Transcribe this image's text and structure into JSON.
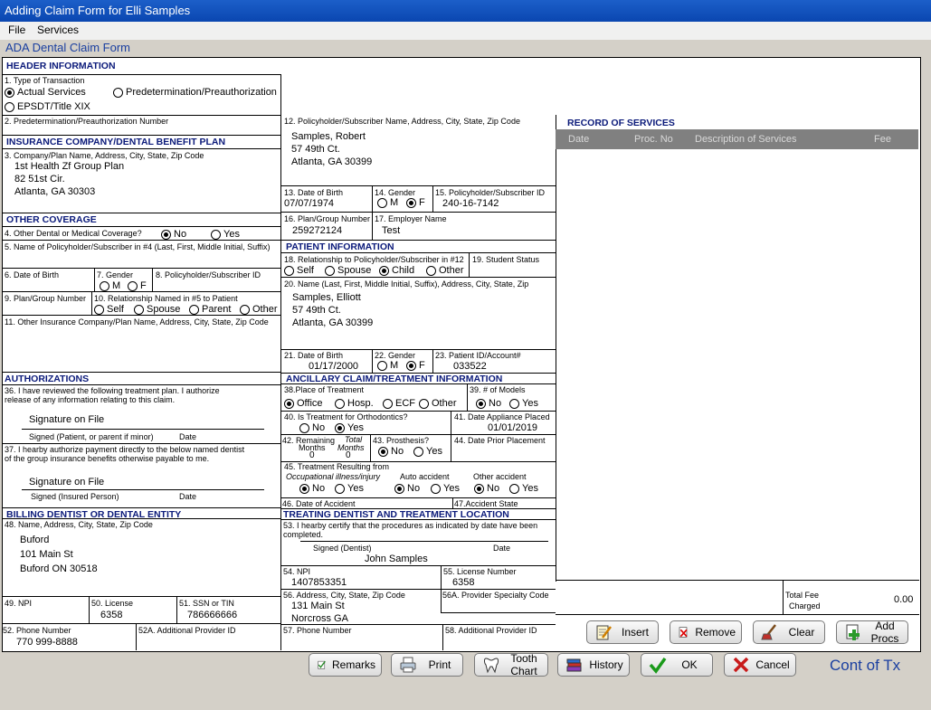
{
  "window": {
    "title": "Adding Claim Form for Elli Samples"
  },
  "menu": [
    "File",
    "Services"
  ],
  "form_title": "ADA Dental Claim Form",
  "header": {
    "title": "HEADER INFORMATION",
    "type_label": "1. Type of Transaction",
    "actual": "Actual Services",
    "predet": "Predetermination/Preauthorization",
    "epsdt": "EPSDT/Title XIX",
    "predet_num_label": "2. Predetermination/Preauthorization Number"
  },
  "insurance": {
    "title": "INSURANCE COMPANY/DENTAL BENEFIT PLAN",
    "label": "3. Company/Plan Name, Address, City, State, Zip Code",
    "lines": [
      "1st Health Zf Group Plan",
      "82 51st Cir.",
      "Atlanta, GA  30303"
    ]
  },
  "other_coverage": {
    "title": "OTHER COVERAGE",
    "q4": "4. Other Dental or Medical Coverage?",
    "no": "No",
    "yes": "Yes",
    "l5": "5. Name of Policyholder/Subscriber in #4 (Last, First, Middle Initial, Suffix)",
    "l6": "6. Date of Birth",
    "l7": "7. Gender",
    "m": "M",
    "f": "F",
    "l8": "8. Policyholder/Subscriber ID",
    "l9": "9. Plan/Group Number",
    "l10": "10. Relationship Named in #5 to Patient",
    "self": "Self",
    "spouse": "Spouse",
    "parent": "Parent",
    "other": "Other",
    "l11": "11. Other Insurance Company/Plan  Name, Address, City, State, Zip Code"
  },
  "authorizations": {
    "title": "AUTHORIZATIONS",
    "l36a": "36. I have reviewed the following treatment plan.  I authorize",
    "l36b": "release of any information relating to this claim.",
    "sig1": "Signature on File",
    "sig1_label": "Signed (Patient, or parent if minor)",
    "date": "Date",
    "l37a": "37. I hearby authorize payment directly to the below named dentist",
    "l37b": "of the group insurance benefits otherwise payable to me.",
    "sig2": "Signature on File",
    "sig2_label": "Signed (Insured Person)"
  },
  "billing": {
    "title": "BILLING DENTIST OR DENTAL ENTITY",
    "l48": "48. Name, Address, City, State, Zip Code",
    "lines": [
      "Buford",
      "101 Main St",
      "Buford ON 30518"
    ],
    "l49": "49. NPI",
    "l50": "50. License",
    "license": "6358",
    "l51": "51. SSN or TIN",
    "ssn": "786666666",
    "l52": "52. Phone Number",
    "phone": "770 999-8888",
    "l52a": "52A. Additional Provider ID"
  },
  "subscriber": {
    "l12": "12. Policyholder/Subscriber Name, Address, City, State, Zip Code",
    "lines": [
      "Samples, Robert",
      "57 49th Ct.",
      "Atlanta, GA  30399"
    ],
    "l13": "13. Date of Birth",
    "dob": "07/07/1974",
    "l14": "14. Gender",
    "m": "M",
    "f": "F",
    "l15": "15. Policyholder/Subscriber ID",
    "id": "240-16-7142",
    "l16": "16. Plan/Group Number",
    "plan": "259272124",
    "l17": "17. Employer Name",
    "employer": "Test"
  },
  "patient": {
    "title": "PATIENT INFORMATION",
    "l18": "18. Relationship to Policyholder/Subscriber in #12",
    "self": "Self",
    "spouse": "Spouse",
    "child": "Child",
    "other": "Other",
    "l19": "19. Student Status",
    "l20": "20.  Name (Last, First, Middle Initial, Suffix), Address, City, State, Zip",
    "lines": [
      "Samples, Elliott",
      "57 49th Ct.",
      "Atlanta, GA  30399"
    ],
    "l21": "21. Date of Birth",
    "dob": "01/17/2000",
    "l22": "22. Gender",
    "m": "M",
    "f": "F",
    "l23": "23. Patient ID/Account#",
    "account": "033522"
  },
  "ancillary": {
    "title": "ANCILLARY CLAIM/TREATMENT INFORMATION",
    "l38": "38.Place of Treatment",
    "office": "Office",
    "hosp": "Hosp.",
    "ecf": "ECF",
    "other": "Other",
    "l39": "39. # of Models",
    "no": "No",
    "yes": "Yes",
    "l40": "40. Is Treatment for Orthodontics?",
    "l41": "41. Date Appliance Placed",
    "appliance_date": "01/01/2019",
    "l42a": "42. Remaining",
    "l42b": "Months",
    "l42c": "Total",
    "l42d": "Months",
    "months_remaining": "0",
    "months_total": "0",
    "l43": "43. Prosthesis?",
    "l44": "44. Date Prior Placement",
    "l45": "45. Treatment Resulting from",
    "occ": "Occupational illness/injury",
    "auto": "Auto accident",
    "oth": "Other accident",
    "l46": "46. Date of Accident",
    "l47": "47.Accident State"
  },
  "treating": {
    "title": "TREATING DENTIST AND TREATMENT LOCATION",
    "l53a": "53. I hearby certify that the procedures as indicated by date have been",
    "l53b": "completed.",
    "signed": "Signed (Dentist)",
    "date": "Date",
    "dentist": "John Samples",
    "l54": "54. NPI",
    "npi": "1407853351",
    "l55": "55. License Number",
    "license": "6358",
    "l56": "56. Address, City, State, Zip Code",
    "lines": [
      "131 Main St",
      "Norcross GA"
    ],
    "l56a": "56A. Provider Specialty Code",
    "l57": "57. Phone Number",
    "l58": "58. Additional Provider ID"
  },
  "services": {
    "title": "RECORD OF SERVICES",
    "columns": [
      "Date",
      "Proc. No",
      "Description of Services",
      "Fee"
    ],
    "total_label1": "Total Fee",
    "total_label2": "Charged",
    "total": "0.00"
  },
  "service_buttons": {
    "insert": "Insert",
    "remove": "Remove",
    "clear": "Clear",
    "add": "Add Procs"
  },
  "bottom_buttons": {
    "remarks": "Remarks",
    "print": "Print",
    "tooth": "Tooth Chart",
    "history": "History",
    "ok": "OK",
    "cancel": "Cancel"
  },
  "cont_link": "Cont of Tx"
}
